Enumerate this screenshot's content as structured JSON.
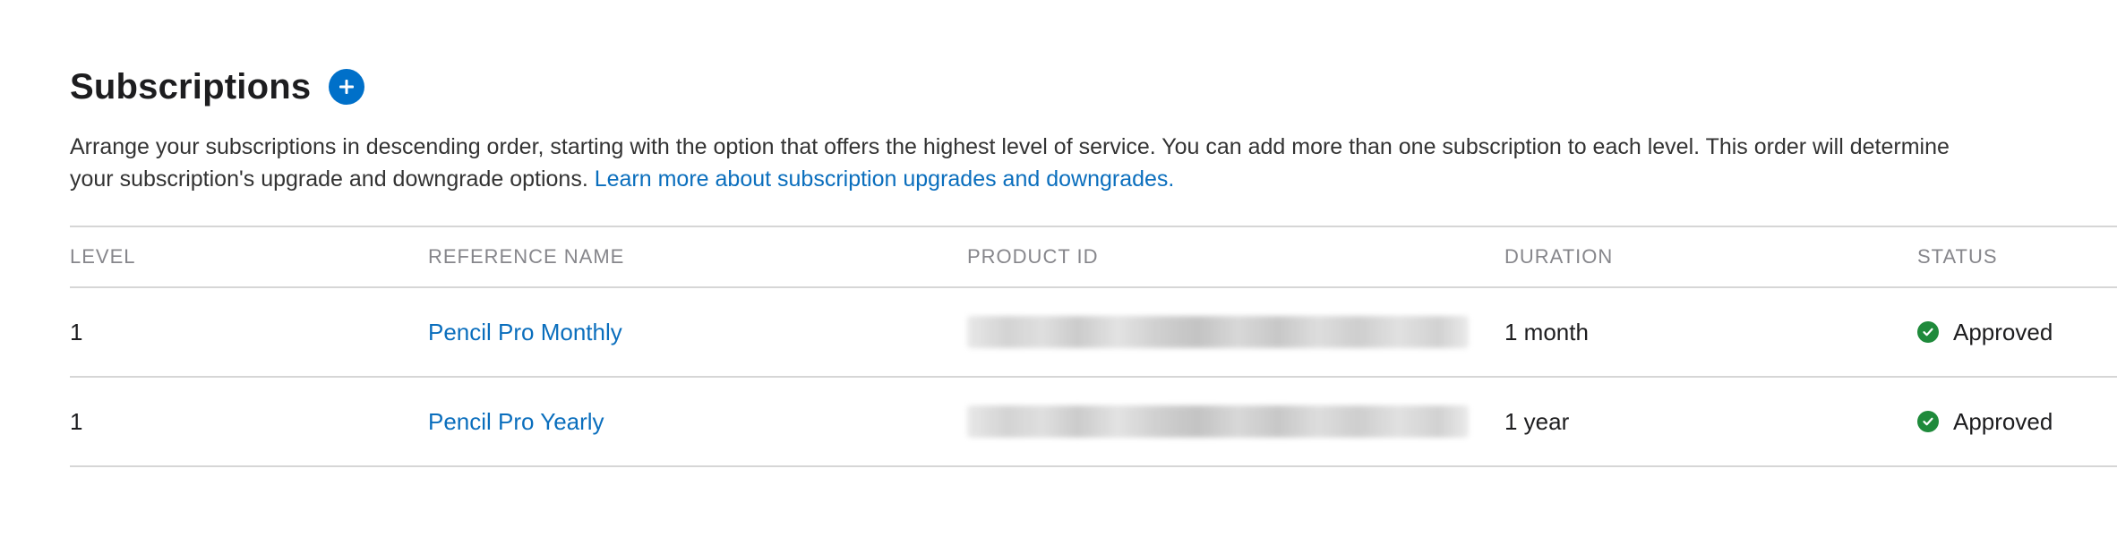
{
  "header": {
    "title": "Subscriptions",
    "add_icon": "plus-circle-icon"
  },
  "description": {
    "line1": "Arrange your subscriptions in descending order, starting with the option that offers the highest level of service. You can add more than one subscription to each level. This order will determine",
    "line2": "your subscription's upgrade and downgrade options.",
    "link": "Learn more about subscription upgrades and downgrades."
  },
  "table": {
    "columns": [
      "LEVEL",
      "REFERENCE NAME",
      "PRODUCT ID",
      "DURATION",
      "STATUS"
    ],
    "rows": [
      {
        "level": "1",
        "reference_name": "Pencil Pro Monthly",
        "duration": "1 month",
        "status": "Approved"
      },
      {
        "level": "1",
        "reference_name": "Pencil Pro Yearly",
        "duration": "1 year",
        "status": "Approved"
      }
    ]
  },
  "colors": {
    "accent": "#0070c9",
    "link": "#0a6ebd",
    "approved": "#1f8a3b"
  },
  "icons": {
    "status": "check-circle-icon"
  }
}
